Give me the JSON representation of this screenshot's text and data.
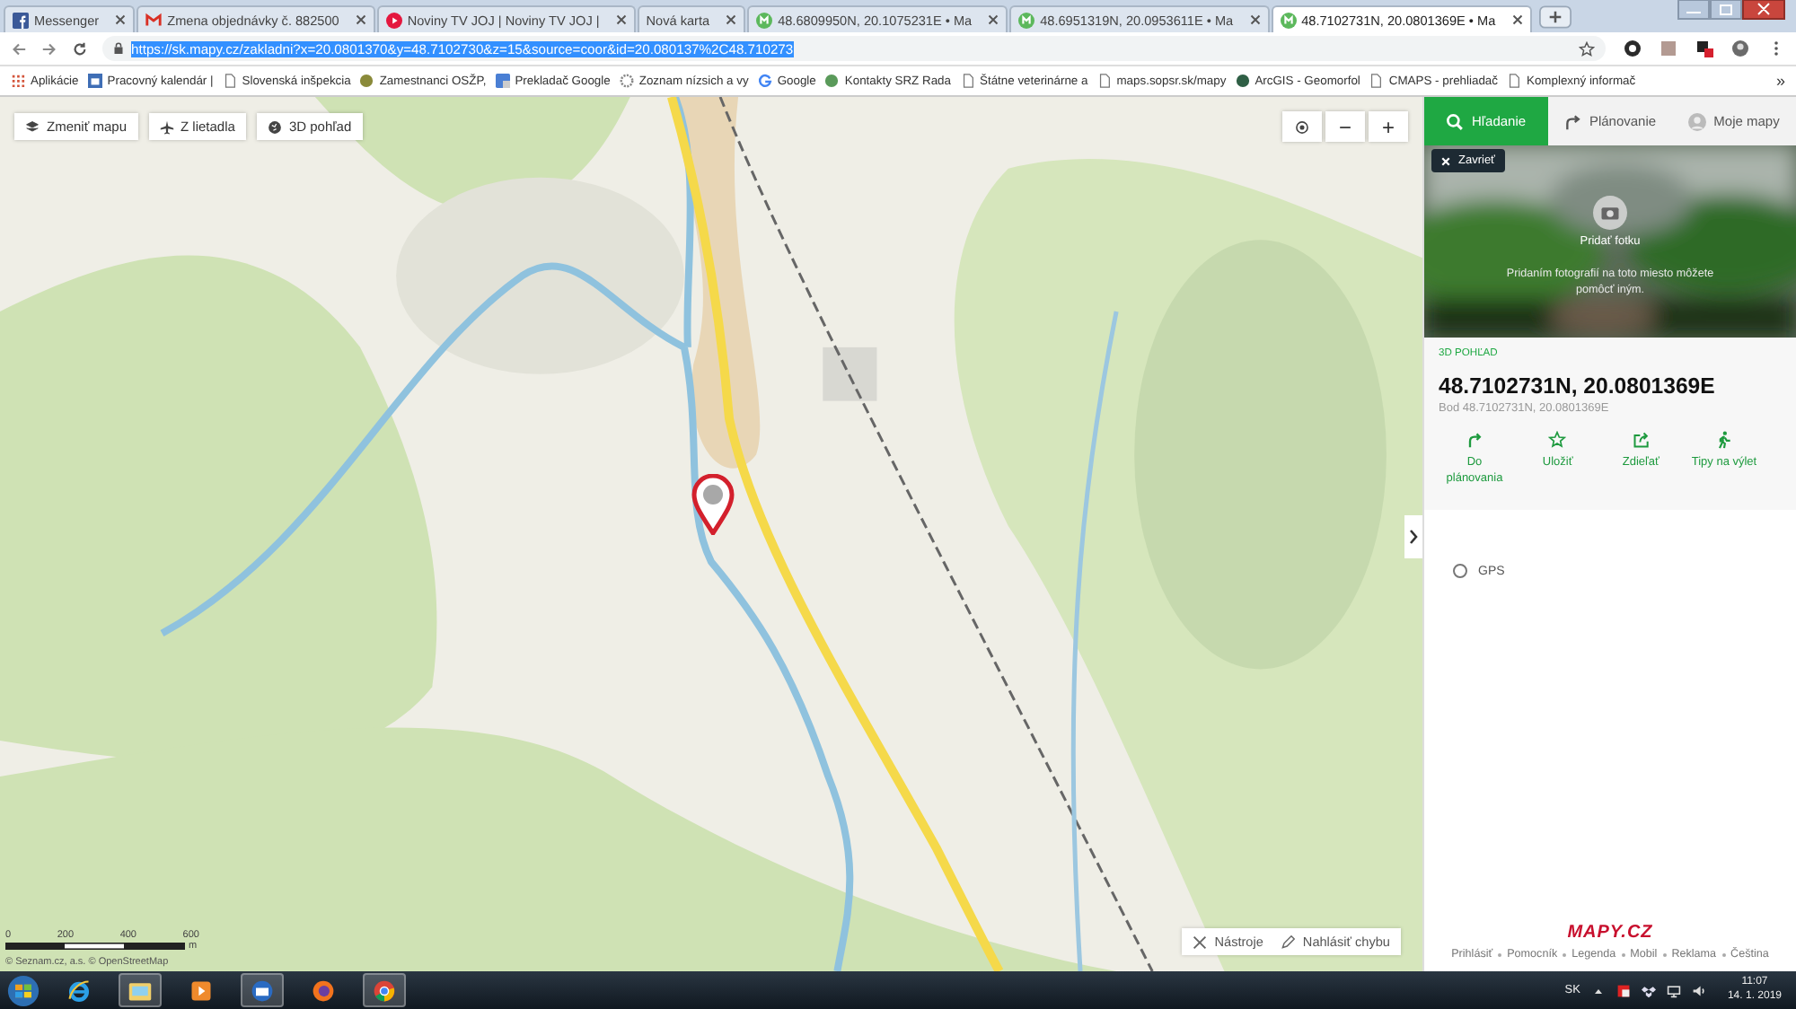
{
  "browser": {
    "tabs": [
      {
        "title": "Messenger",
        "kind": "facebook",
        "selected": false
      },
      {
        "title": "Zmena objednávky č. 882500",
        "kind": "gmail",
        "selected": false
      },
      {
        "title": "Noviny TV JOJ | Noviny TV JOJ |",
        "kind": "tv",
        "selected": false
      },
      {
        "title": "Nová karta",
        "kind": "blank",
        "selected": false
      },
      {
        "title": "48.6809950N, 20.1075231E • Ma",
        "kind": "mapy",
        "selected": false
      },
      {
        "title": "48.6951319N, 20.0953611E • Ma",
        "kind": "mapy",
        "selected": false
      },
      {
        "title": "48.7102731N, 20.0801369E • Ma",
        "kind": "mapy",
        "selected": true
      }
    ],
    "address": {
      "url": "https://sk.mapy.cz/zakladni?x=20.0801370&y=48.7102730&z=15&source=coor&id=20.080137%2C48.710273",
      "text_selected": true
    },
    "bookmarks": [
      {
        "label": "Aplikácie",
        "kind": "apps"
      },
      {
        "label": "Pracovný kalendár | ",
        "kind": "calendar"
      },
      {
        "label": "Slovenská inšpekcia ",
        "kind": "page"
      },
      {
        "label": "Zamestnanci OSŽP, ",
        "kind": "emblem"
      },
      {
        "label": "Prekladač Google",
        "kind": "translate"
      },
      {
        "label": "Zoznam nízsich a vy",
        "kind": "gear"
      },
      {
        "label": "Google",
        "kind": "google"
      },
      {
        "label": "Kontakty SRZ Rada ",
        "kind": "leaf"
      },
      {
        "label": "Štátne veterinárne a ",
        "kind": "page"
      },
      {
        "label": "maps.sopsr.sk/mapy",
        "kind": "page"
      },
      {
        "label": "ArcGIS - Geomorfol",
        "kind": "globe"
      },
      {
        "label": "CMAPS - prehliadač ",
        "kind": "page"
      },
      {
        "label": "Komplexný informač",
        "kind": "page"
      }
    ],
    "bookmarks_more": "»"
  },
  "map": {
    "buttons": [
      {
        "label": "Zmeniť mapu",
        "kind": "layers"
      },
      {
        "label": "Z lietadla",
        "kind": "plane"
      },
      {
        "label": "3D pohľad",
        "kind": "globe"
      }
    ],
    "zoom_out": "−",
    "zoom_in": "+",
    "scale": {
      "labels": [
        "0",
        "200",
        "400",
        "600"
      ],
      "unit": "m"
    },
    "attribution": "© Seznam.cz, a.s. © OpenStreetMap",
    "tools": [
      {
        "label": "Nástroje",
        "kind": "tools"
      },
      {
        "label": "Nahlásiť chybu",
        "kind": "pencil"
      }
    ]
  },
  "panel": {
    "tabs": [
      {
        "label": "Hľadanie",
        "kind": "search",
        "selected": true
      },
      {
        "label": "Plánovanie",
        "kind": "route",
        "selected": false
      },
      {
        "label": "Moje mapy",
        "kind": "user",
        "selected": false
      }
    ],
    "close": "Zavrieť",
    "add_photo": "Pridať fotku",
    "photo_hint": "Pridaním fotografií na toto miesto môžete pomôcť iným.",
    "section": "3D POHĽAD",
    "title": "48.7102731N, 20.0801369E",
    "subtitle": "Bod 48.7102731N, 20.0801369E",
    "actions": [
      {
        "label": "Do plánovania",
        "kind": "route"
      },
      {
        "label": "Uložiť",
        "kind": "star"
      },
      {
        "label": "Zdieľať",
        "kind": "share"
      },
      {
        "label": "Tipy na výlet",
        "kind": "walk"
      }
    ],
    "gps": {
      "label": "GPS",
      "checked": false
    },
    "logo": "MAPY.CZ",
    "footer_links": [
      "Prihlásiť",
      "Pomocník",
      "Legenda",
      "Mobil",
      "Reklama",
      "Čeština"
    ]
  },
  "taskbar": {
    "apps": [
      {
        "kind": "ie",
        "running": false
      },
      {
        "kind": "explorer",
        "running": true
      },
      {
        "kind": "media",
        "running": false
      },
      {
        "kind": "outlook",
        "running": true
      },
      {
        "kind": "firefox",
        "running": false
      },
      {
        "kind": "chrome",
        "running": true
      }
    ],
    "language": "SK",
    "time": "11:07",
    "date": "14. 1. 2019"
  }
}
